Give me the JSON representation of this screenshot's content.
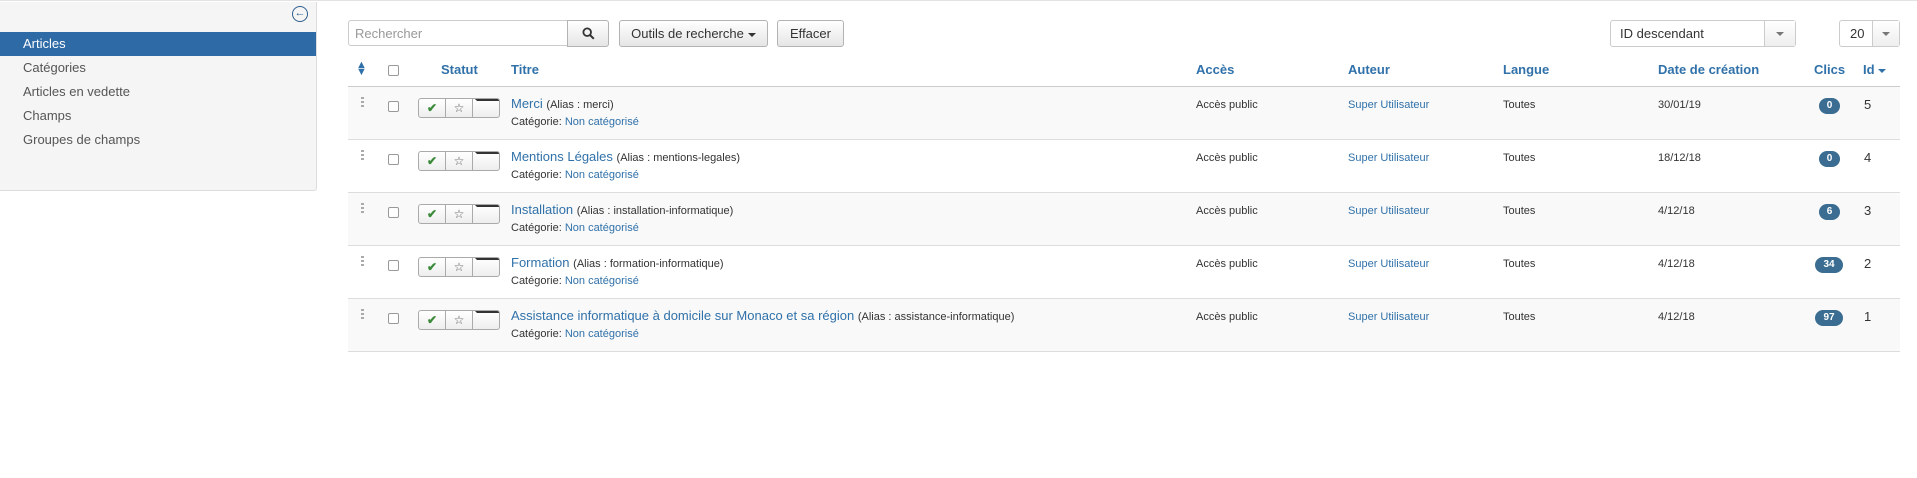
{
  "sidebar": {
    "toggle_icon": "arrow-circle-left-icon",
    "items": [
      {
        "label": "Articles",
        "active": true
      },
      {
        "label": "Catégories",
        "active": false
      },
      {
        "label": "Articles en vedette",
        "active": false
      },
      {
        "label": "Champs",
        "active": false
      },
      {
        "label": "Groupes de champs",
        "active": false
      }
    ]
  },
  "toolbar": {
    "search_placeholder": "Rechercher",
    "search_value": "",
    "search_icon": "search-icon",
    "tools_label": "Outils de recherche",
    "clear_label": "Effacer",
    "order_value": "ID descendant",
    "limit_value": "20"
  },
  "table": {
    "headers": {
      "status": "Statut",
      "title": "Titre",
      "access": "Accès",
      "author": "Auteur",
      "language": "Langue",
      "created": "Date de création",
      "hits": "Clics",
      "id": "Id"
    },
    "category_prefix": "Catégorie:",
    "rows": [
      {
        "title": "Merci",
        "alias": "(Alias : merci)",
        "category": "Non catégorisé",
        "access": "Accès public",
        "author": "Super Utilisateur",
        "language": "Toutes",
        "created": "30/01/19",
        "hits": "0",
        "id": "5"
      },
      {
        "title": "Mentions Légales",
        "alias": "(Alias : mentions-legales)",
        "category": "Non catégorisé",
        "access": "Accès public",
        "author": "Super Utilisateur",
        "language": "Toutes",
        "created": "18/12/18",
        "hits": "0",
        "id": "4"
      },
      {
        "title": "Installation",
        "alias": "(Alias : installation-informatique)",
        "category": "Non catégorisé",
        "access": "Accès public",
        "author": "Super Utilisateur",
        "language": "Toutes",
        "created": "4/12/18",
        "hits": "6",
        "id": "3"
      },
      {
        "title": "Formation",
        "alias": "(Alias : formation-informatique)",
        "category": "Non catégorisé",
        "access": "Accès public",
        "author": "Super Utilisateur",
        "language": "Toutes",
        "created": "4/12/18",
        "hits": "34",
        "id": "2"
      },
      {
        "title": "Assistance informatique à domicile sur Monaco et sa région",
        "alias": "(Alias : assistance-informatique)",
        "category": "Non catégorisé",
        "access": "Accès public",
        "author": "Super Utilisateur",
        "language": "Toutes",
        "created": "4/12/18",
        "hits": "97",
        "id": "1"
      }
    ]
  },
  "colors": {
    "accent": "#2d6aa6",
    "link": "#3071a9",
    "badge": "#3a6d91",
    "published": "#3a8a3a"
  }
}
